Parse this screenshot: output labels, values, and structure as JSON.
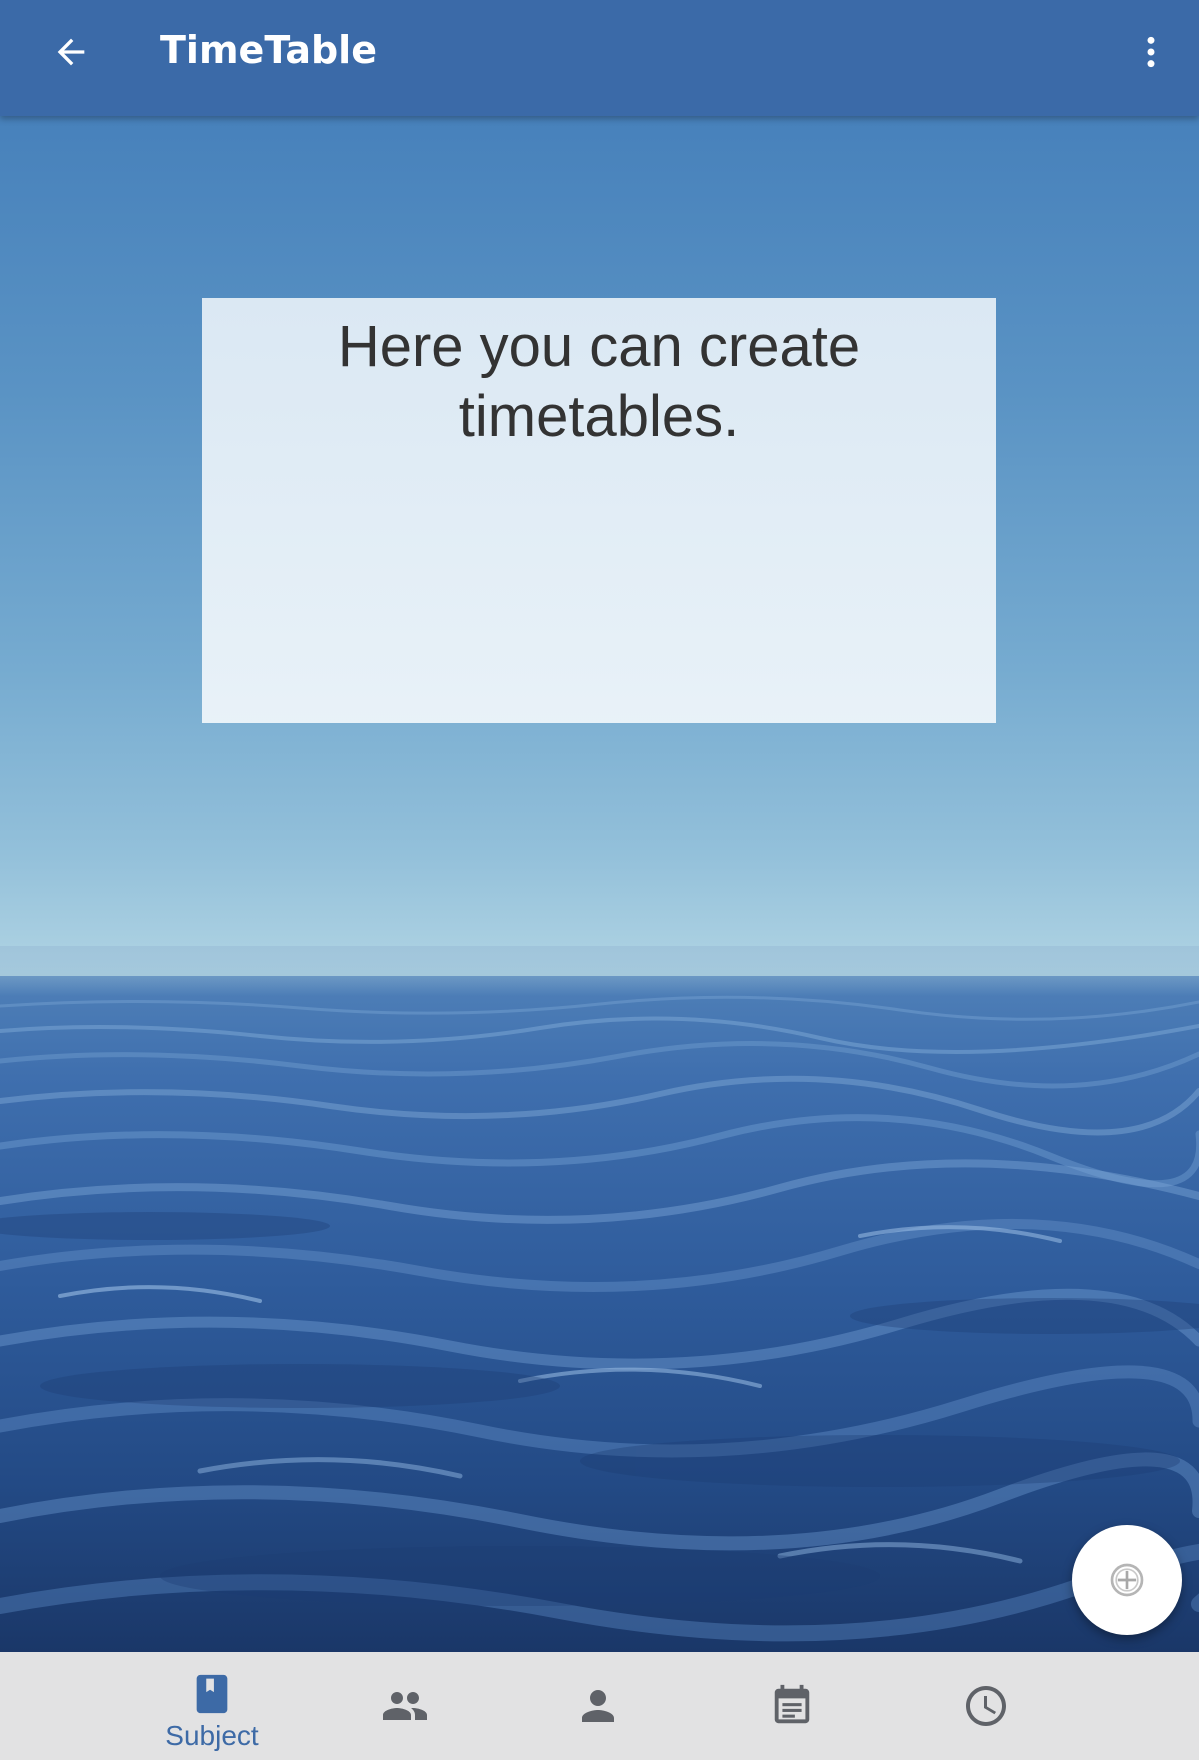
{
  "appbar": {
    "title": "TimeTable",
    "back_icon": "arrow-left-icon",
    "menu_icon": "more-vertical-icon",
    "color": "#3b6aa8"
  },
  "main": {
    "info_text": "Here you can create timetables."
  },
  "fab": {
    "icon": "add-circle-icon"
  },
  "bottom_nav": {
    "active_color": "#3d6aa6",
    "inactive_color": "#5f6268",
    "items": [
      {
        "label": "Subject",
        "icon": "book-icon",
        "active": true
      },
      {
        "label": "",
        "icon": "people-icon",
        "active": false
      },
      {
        "label": "",
        "icon": "person-icon",
        "active": false
      },
      {
        "label": "",
        "icon": "calendar-icon",
        "active": false
      },
      {
        "label": "",
        "icon": "clock-icon",
        "active": false
      }
    ]
  }
}
